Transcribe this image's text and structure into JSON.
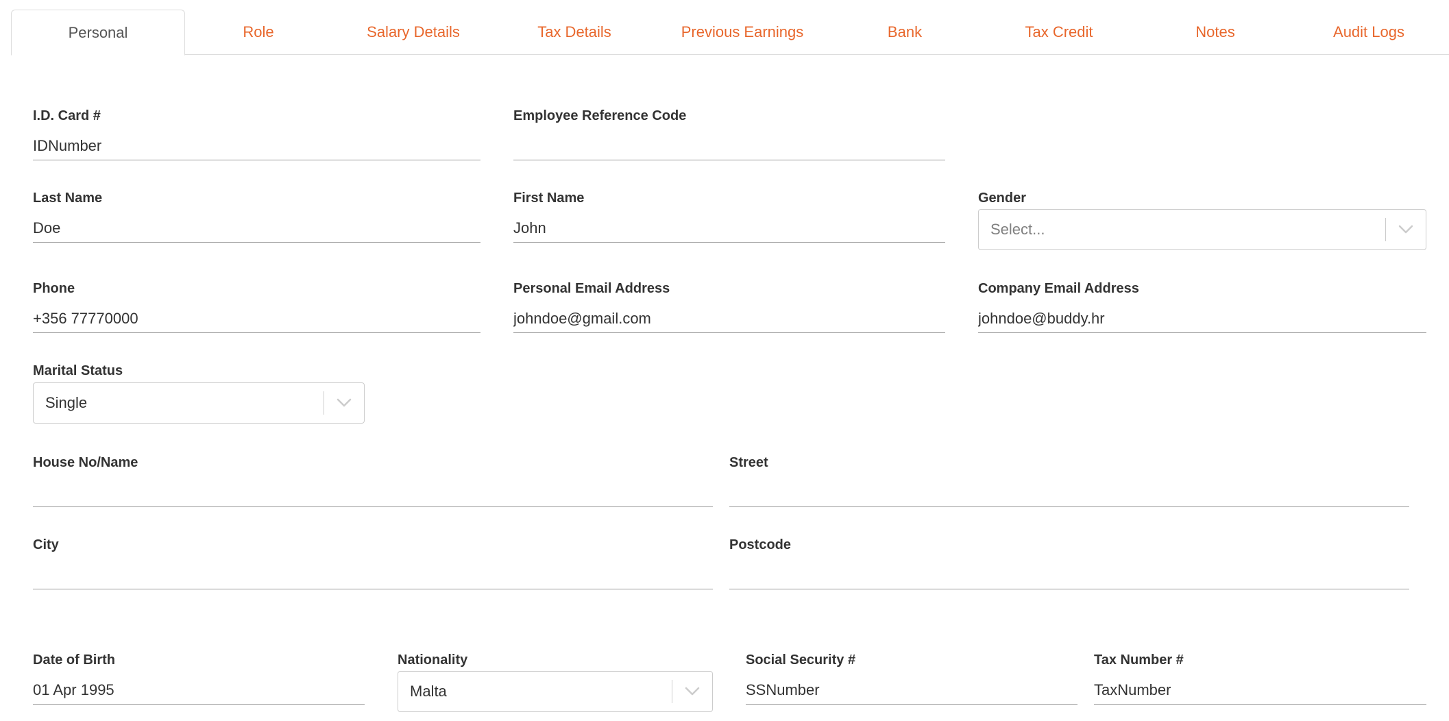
{
  "tabs": [
    {
      "label": "Personal",
      "active": true
    },
    {
      "label": "Role"
    },
    {
      "label": "Salary Details"
    },
    {
      "label": "Tax Details"
    },
    {
      "label": "Previous Earnings"
    },
    {
      "label": "Bank"
    },
    {
      "label": "Tax Credit"
    },
    {
      "label": "Notes"
    },
    {
      "label": "Audit Logs"
    }
  ],
  "colors": {
    "accent": "#e8672c",
    "label": "#333333",
    "border": "#cccccc",
    "underline": "#999999"
  },
  "form": {
    "id_card": {
      "label": "I.D. Card #",
      "value": "IDNumber"
    },
    "employee_ref": {
      "label": "Employee Reference Code",
      "value": ""
    },
    "last_name": {
      "label": "Last Name",
      "value": "Doe"
    },
    "first_name": {
      "label": "First Name",
      "value": "John"
    },
    "gender": {
      "label": "Gender",
      "placeholder": "Select...",
      "icon": "chevron-down-icon"
    },
    "phone": {
      "label": "Phone",
      "value": "+356 77770000"
    },
    "personal_email": {
      "label": "Personal Email Address",
      "value": "johndoe@gmail.com"
    },
    "company_email": {
      "label": "Company Email Address",
      "value": "johndoe@buddy.hr"
    },
    "marital_status": {
      "label": "Marital Status",
      "value": "Single",
      "icon": "chevron-down-icon"
    },
    "house": {
      "label": "House No/Name",
      "value": ""
    },
    "street": {
      "label": "Street",
      "value": ""
    },
    "city": {
      "label": "City",
      "value": ""
    },
    "postcode": {
      "label": "Postcode",
      "value": ""
    },
    "dob": {
      "label": "Date of Birth",
      "value": "01 Apr 1995"
    },
    "nationality": {
      "label": "Nationality",
      "value": "Malta",
      "icon": "chevron-down-icon"
    },
    "social_security": {
      "label": "Social Security #",
      "value": "SSNumber"
    },
    "tax_number": {
      "label": "Tax Number #",
      "value": "TaxNumber"
    }
  }
}
